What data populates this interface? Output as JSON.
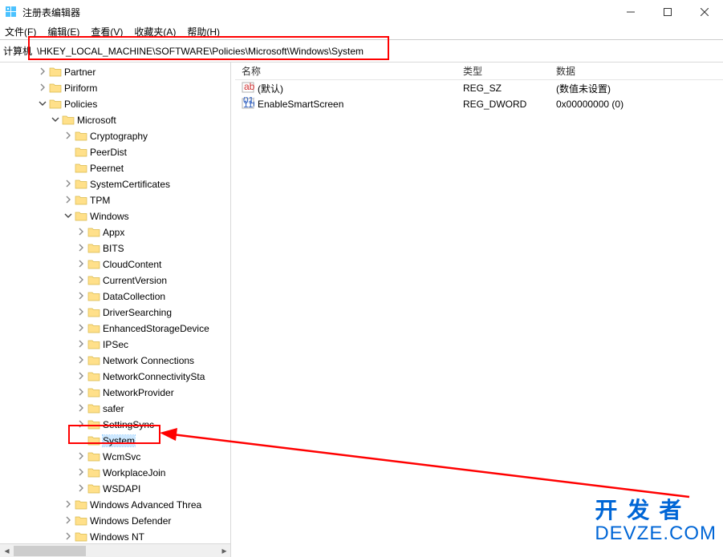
{
  "window": {
    "title": "注册表编辑器"
  },
  "menu": {
    "file": "文件(F)",
    "edit": "编辑(E)",
    "view": "查看(V)",
    "fav": "收藏夹(A)",
    "help": "帮助(H)"
  },
  "address": {
    "label": "计算机",
    "path": "\\HKEY_LOCAL_MACHINE\\SOFTWARE\\Policies\\Microsoft\\Windows\\System"
  },
  "tree": [
    {
      "indent": 60,
      "exp": ">",
      "label": "Partner"
    },
    {
      "indent": 60,
      "exp": ">",
      "label": "Piriform"
    },
    {
      "indent": 60,
      "exp": "v",
      "label": "Policies"
    },
    {
      "indent": 76,
      "exp": "v",
      "label": "Microsoft"
    },
    {
      "indent": 92,
      "exp": ">",
      "label": "Cryptography"
    },
    {
      "indent": 92,
      "exp": "",
      "label": "PeerDist"
    },
    {
      "indent": 92,
      "exp": "",
      "label": "Peernet"
    },
    {
      "indent": 92,
      "exp": ">",
      "label": "SystemCertificates"
    },
    {
      "indent": 92,
      "exp": ">",
      "label": "TPM"
    },
    {
      "indent": 92,
      "exp": "v",
      "label": "Windows"
    },
    {
      "indent": 108,
      "exp": ">",
      "label": "Appx"
    },
    {
      "indent": 108,
      "exp": ">",
      "label": "BITS"
    },
    {
      "indent": 108,
      "exp": ">",
      "label": "CloudContent"
    },
    {
      "indent": 108,
      "exp": ">",
      "label": "CurrentVersion"
    },
    {
      "indent": 108,
      "exp": ">",
      "label": "DataCollection"
    },
    {
      "indent": 108,
      "exp": ">",
      "label": "DriverSearching"
    },
    {
      "indent": 108,
      "exp": ">",
      "label": "EnhancedStorageDevice"
    },
    {
      "indent": 108,
      "exp": ">",
      "label": "IPSec"
    },
    {
      "indent": 108,
      "exp": ">",
      "label": "Network Connections"
    },
    {
      "indent": 108,
      "exp": ">",
      "label": "NetworkConnectivitySta"
    },
    {
      "indent": 108,
      "exp": ">",
      "label": "NetworkProvider"
    },
    {
      "indent": 108,
      "exp": ">",
      "label": "safer"
    },
    {
      "indent": 108,
      "exp": ">",
      "label": "SettingSync"
    },
    {
      "indent": 108,
      "exp": "",
      "label": "System",
      "selected": true
    },
    {
      "indent": 108,
      "exp": ">",
      "label": "WcmSvc"
    },
    {
      "indent": 108,
      "exp": ">",
      "label": "WorkplaceJoin"
    },
    {
      "indent": 108,
      "exp": ">",
      "label": "WSDAPI"
    },
    {
      "indent": 92,
      "exp": ">",
      "label": "Windows Advanced Threa"
    },
    {
      "indent": 92,
      "exp": ">",
      "label": "Windows Defender"
    },
    {
      "indent": 92,
      "exp": ">",
      "label": "Windows NT"
    }
  ],
  "list": {
    "headers": {
      "name": "名称",
      "type": "类型",
      "data": "数据"
    },
    "rows": [
      {
        "icon": "str",
        "name": "(默认)",
        "type": "REG_SZ",
        "data": "(数值未设置)"
      },
      {
        "icon": "bin",
        "name": "EnableSmartScreen",
        "type": "REG_DWORD",
        "data": "0x00000000 (0)"
      }
    ]
  },
  "watermark": {
    "line1": "开发者",
    "line2": "DEVZE.COM"
  }
}
